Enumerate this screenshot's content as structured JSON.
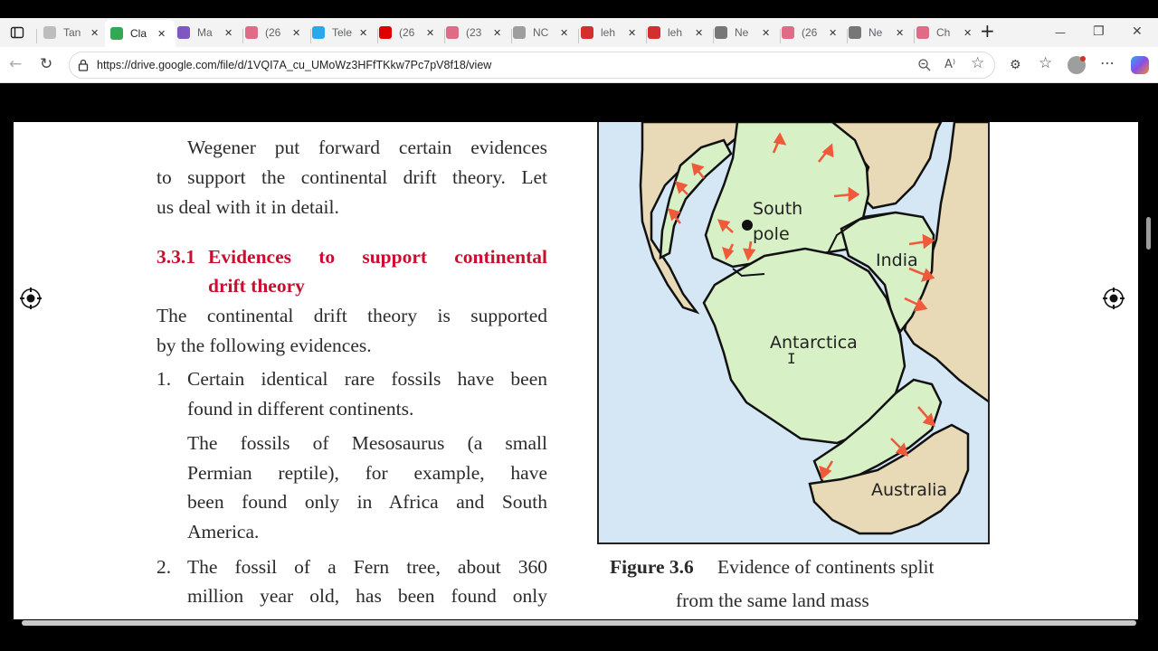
{
  "browser": {
    "tabs": [
      {
        "label": "Tan",
        "icon": "document-icon",
        "color": "#bdbdbd"
      },
      {
        "label": "Cla",
        "icon": "google-drive-icon",
        "color": "#34a853",
        "active": true
      },
      {
        "label": "Ma",
        "icon": "app-icon",
        "color": "#7e57c2"
      },
      {
        "label": "(26",
        "icon": "youtube-icon",
        "color": "#e06b86"
      },
      {
        "label": "Tele",
        "icon": "telegram-icon",
        "color": "#29a9eb"
      },
      {
        "label": "(26",
        "icon": "youtube-icon",
        "color": "#e00000"
      },
      {
        "label": "(23",
        "icon": "youtube-icon",
        "color": "#e06b86"
      },
      {
        "label": "NC",
        "icon": "globe-icon",
        "color": "#9e9e9e"
      },
      {
        "label": "leh",
        "icon": "pdf-icon",
        "color": "#d32f2f"
      },
      {
        "label": "leh",
        "icon": "pdf-icon",
        "color": "#d32f2f"
      },
      {
        "label": "Ne",
        "icon": "page-icon",
        "color": "#777777"
      },
      {
        "label": "(26",
        "icon": "youtube-icon",
        "color": "#e06b86"
      },
      {
        "label": "Ne",
        "icon": "page-icon",
        "color": "#777777"
      },
      {
        "label": "Ch",
        "icon": "youtube-icon",
        "color": "#e06b86"
      }
    ],
    "new_tab": "+",
    "url": "https://drive.google.com/file/d/1VQI7A_cu_UMoWz3HFfTKkw7Pc7pV8f18/view",
    "window_controls": {
      "minimize": "—",
      "restore": "❐",
      "close": "✕"
    }
  },
  "document": {
    "paragraph1": [
      "Wegener put forward certain evidences",
      "to support the continental drift theory. Let",
      "us deal with it in detail."
    ],
    "heading_number": "3.3.1",
    "heading_line1": "Evidences to support continental",
    "heading_line2": "drift theory",
    "paragraph2": [
      "The continental drift theory is supported",
      "by the following evidences."
    ],
    "item1_number": "1.",
    "item1_lines": [
      "Certain identical rare fossils have been",
      "found in different continents."
    ],
    "item1_detail": [
      "The fossils of Mesosaurus (a small",
      "Permian reptile), for example, have",
      "been found only in Africa and South",
      "America."
    ],
    "item2_number": "2.",
    "item2_lines": [
      "The fossil of a Fern tree, about 360",
      "million year old, has been found only"
    ]
  },
  "figure": {
    "labels": {
      "south_pole_1": "South",
      "south_pole_2": "pole",
      "india": "India",
      "antarctica": "Antarctica",
      "australia": "Australia"
    },
    "caption_number": "Figure 3.6",
    "caption_line1": "Evidence of continents split",
    "caption_line2": "from the same land mass",
    "colors": {
      "ocean": "#d5e6f5",
      "land_green": "#d8f0c6",
      "land_tan": "#e8d9b7",
      "arrow": "#ee5a3a"
    }
  }
}
